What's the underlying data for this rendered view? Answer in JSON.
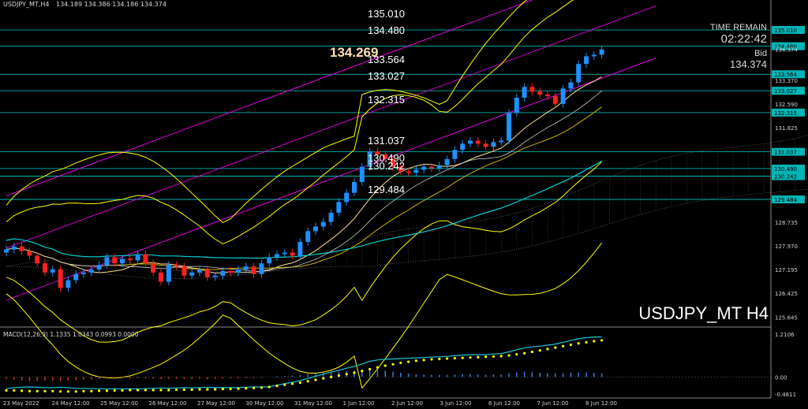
{
  "header": {
    "symbol_tf": "USDJPY_MT,H4",
    "ohlc": "134.189 134.386 134.186 134.374"
  },
  "info": {
    "time_remain_label": "TIME REMAIN",
    "time_remain": "02:22:42",
    "bid_label": "Bid",
    "bid": "134.374",
    "current_price": "134.269"
  },
  "watermark": "USDJPY_MT H4",
  "levels": [
    {
      "label": "135.010",
      "value": 135.01
    },
    {
      "label": "134.480",
      "value": 134.48
    },
    {
      "label": "133.564",
      "value": 133.564
    },
    {
      "label": "133.027",
      "value": 133.027
    },
    {
      "label": "132.315",
      "value": 132.315
    },
    {
      "label": "131.037",
      "value": 131.037
    },
    {
      "label": "130.490",
      "value": 130.49
    },
    {
      "label": "130.242",
      "value": 130.242
    },
    {
      "label": "129.484",
      "value": 129.484
    }
  ],
  "price_axis": [
    "135.010",
    "134.480",
    "134.374",
    "133.564",
    "133.370",
    "133.027",
    "132.315",
    "132.590",
    "131.825",
    "131.037",
    "130.490",
    "130.242",
    "129.484",
    "128.735",
    "127.970",
    "127.195",
    "126.425",
    "125.645"
  ],
  "macd": {
    "label": "MACD(12,26,9) 1.1335 1.0343 0.0993 0.0000",
    "axis": [
      "1.2106",
      "0.00",
      "-0.4811"
    ]
  },
  "colors": {
    "level_line": "#00cccc",
    "bull": "#1e90ff",
    "bear": "#ff2020",
    "channel": "#ff00ff",
    "bands": "#ffff00",
    "ma_slow": "#00ced1"
  },
  "chart_data": {
    "type": "candlestick",
    "title": "USDJPY_MT H4",
    "x_labels": [
      "23 May 2022",
      "24 May 12:00",
      "25 May 12:00",
      "26 May 12:00",
      "27 May 12:00",
      "30 May 12:00",
      "31 May 12:00",
      "1 Jun 12:00",
      "2 Jun 12:00",
      "3 Jun 12:00",
      "6 Jun 12:00",
      "7 Jun 12:00",
      "8 Jun 12:00"
    ],
    "ylim": [
      125.4,
      135.6
    ],
    "close": [
      127.85,
      127.95,
      127.8,
      127.65,
      127.4,
      127.1,
      127.2,
      126.6,
      126.85,
      127.05,
      127.1,
      127.2,
      127.35,
      127.6,
      127.4,
      127.55,
      127.5,
      127.7,
      127.4,
      127.1,
      126.8,
      127.35,
      127.3,
      127.0,
      127.1,
      127.2,
      126.95,
      127.0,
      127.15,
      127.1,
      127.2,
      127.3,
      127.05,
      127.4,
      127.6,
      127.7,
      127.75,
      127.65,
      128.1,
      128.45,
      128.6,
      128.75,
      129.05,
      129.4,
      129.7,
      130.05,
      130.55,
      131.05,
      130.95,
      130.8,
      130.55,
      130.4,
      130.35,
      130.45,
      130.55,
      130.5,
      130.6,
      130.8,
      131.1,
      131.3,
      131.4,
      131.3,
      131.2,
      131.35,
      131.4,
      132.3,
      132.8,
      133.15,
      133.0,
      132.9,
      132.85,
      132.6,
      133.1,
      133.3,
      133.9,
      134.15,
      134.2,
      134.374
    ],
    "macd_hist": [
      -0.05,
      -0.08,
      -0.1,
      -0.12,
      -0.11,
      -0.1,
      -0.1,
      -0.12,
      -0.11,
      -0.09,
      -0.08,
      -0.07,
      -0.06,
      -0.05,
      -0.05,
      -0.04,
      -0.04,
      -0.03,
      -0.04,
      -0.05,
      -0.06,
      -0.05,
      -0.05,
      -0.06,
      -0.05,
      -0.05,
      -0.06,
      -0.05,
      -0.04,
      -0.04,
      -0.03,
      -0.03,
      -0.03,
      -0.02,
      0.0,
      0.02,
      0.03,
      0.04,
      0.06,
      0.08,
      0.1,
      0.12,
      0.14,
      0.15,
      0.17,
      0.18,
      0.2,
      0.22,
      0.21,
      0.18,
      0.15,
      0.12,
      0.1,
      0.08,
      0.07,
      0.06,
      0.06,
      0.06,
      0.07,
      0.08,
      0.08,
      0.07,
      0.06,
      0.07,
      0.07,
      0.1,
      0.13,
      0.15,
      0.14,
      0.12,
      0.11,
      0.1,
      0.11,
      0.12,
      0.13,
      0.13,
      0.12,
      0.0993
    ],
    "macd_signal": [
      -0.38,
      -0.38,
      -0.39,
      -0.4,
      -0.4,
      -0.4,
      -0.4,
      -0.41,
      -0.41,
      -0.41,
      -0.4,
      -0.4,
      -0.39,
      -0.39,
      -0.38,
      -0.38,
      -0.37,
      -0.37,
      -0.37,
      -0.37,
      -0.37,
      -0.37,
      -0.36,
      -0.36,
      -0.36,
      -0.35,
      -0.35,
      -0.35,
      -0.34,
      -0.34,
      -0.33,
      -0.32,
      -0.31,
      -0.3,
      -0.28,
      -0.25,
      -0.22,
      -0.19,
      -0.16,
      -0.12,
      -0.08,
      -0.04,
      0.0,
      0.04,
      0.08,
      0.12,
      0.17,
      0.22,
      0.27,
      0.32,
      0.36,
      0.4,
      0.43,
      0.46,
      0.48,
      0.5,
      0.51,
      0.52,
      0.53,
      0.54,
      0.55,
      0.56,
      0.57,
      0.58,
      0.59,
      0.61,
      0.64,
      0.67,
      0.71,
      0.75,
      0.79,
      0.83,
      0.87,
      0.91,
      0.95,
      0.98,
      1.01,
      1.0343
    ],
    "macd_line": [
      -0.33,
      -0.3,
      -0.29,
      -0.28,
      -0.29,
      -0.3,
      -0.3,
      -0.29,
      -0.3,
      -0.32,
      -0.32,
      -0.33,
      -0.33,
      -0.34,
      -0.33,
      -0.34,
      -0.33,
      -0.34,
      -0.33,
      -0.32,
      -0.31,
      -0.32,
      -0.31,
      -0.3,
      -0.31,
      -0.3,
      -0.29,
      -0.3,
      -0.3,
      -0.3,
      -0.3,
      -0.29,
      -0.28,
      -0.28,
      -0.28,
      -0.23,
      -0.19,
      -0.15,
      -0.1,
      -0.04,
      0.02,
      0.08,
      0.14,
      0.19,
      0.25,
      0.3,
      0.37,
      0.44,
      0.48,
      0.5,
      0.51,
      0.52,
      0.53,
      0.54,
      0.55,
      0.56,
      0.57,
      0.58,
      0.6,
      0.62,
      0.63,
      0.63,
      0.63,
      0.65,
      0.66,
      0.71,
      0.77,
      0.82,
      0.85,
      0.87,
      0.9,
      0.93,
      0.98,
      1.03,
      1.08,
      1.11,
      1.13,
      1.1335
    ]
  }
}
